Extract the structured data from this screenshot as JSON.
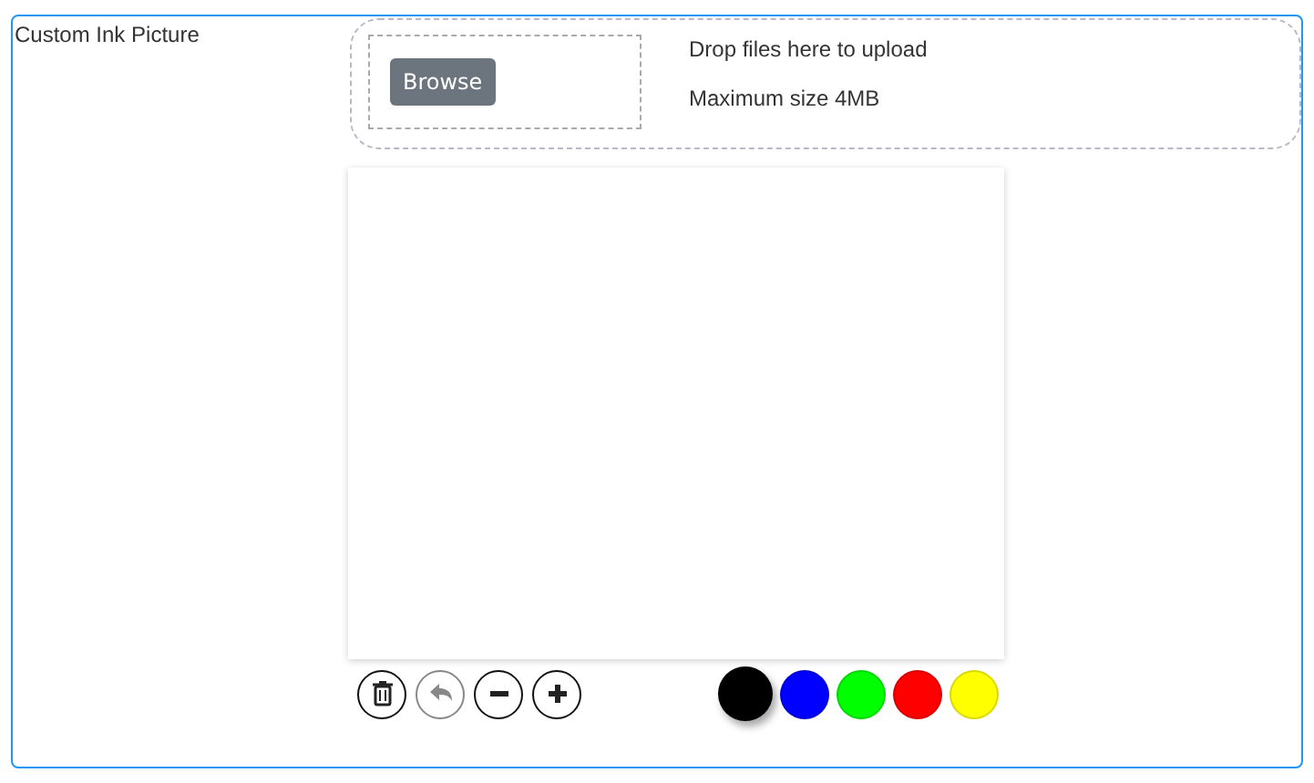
{
  "field": {
    "label": "Custom Ink Picture"
  },
  "upload": {
    "button": "Browse",
    "hint": "Drop files here to upload",
    "limit": "Maximum size 4MB"
  },
  "tools": [
    {
      "kind": "clear",
      "disabled": false
    },
    {
      "kind": "undo",
      "disabled": true
    },
    {
      "kind": "thinner",
      "disabled": false
    },
    {
      "kind": "thicker",
      "disabled": false
    }
  ],
  "colors": [
    {
      "color": "#000000",
      "selected": true
    },
    {
      "color": "#0000ff",
      "selected": false
    },
    {
      "color": "#00ff00",
      "selected": false
    },
    {
      "color": "#ff0000",
      "selected": false
    },
    {
      "color": "#ffff00",
      "selected": false
    }
  ]
}
